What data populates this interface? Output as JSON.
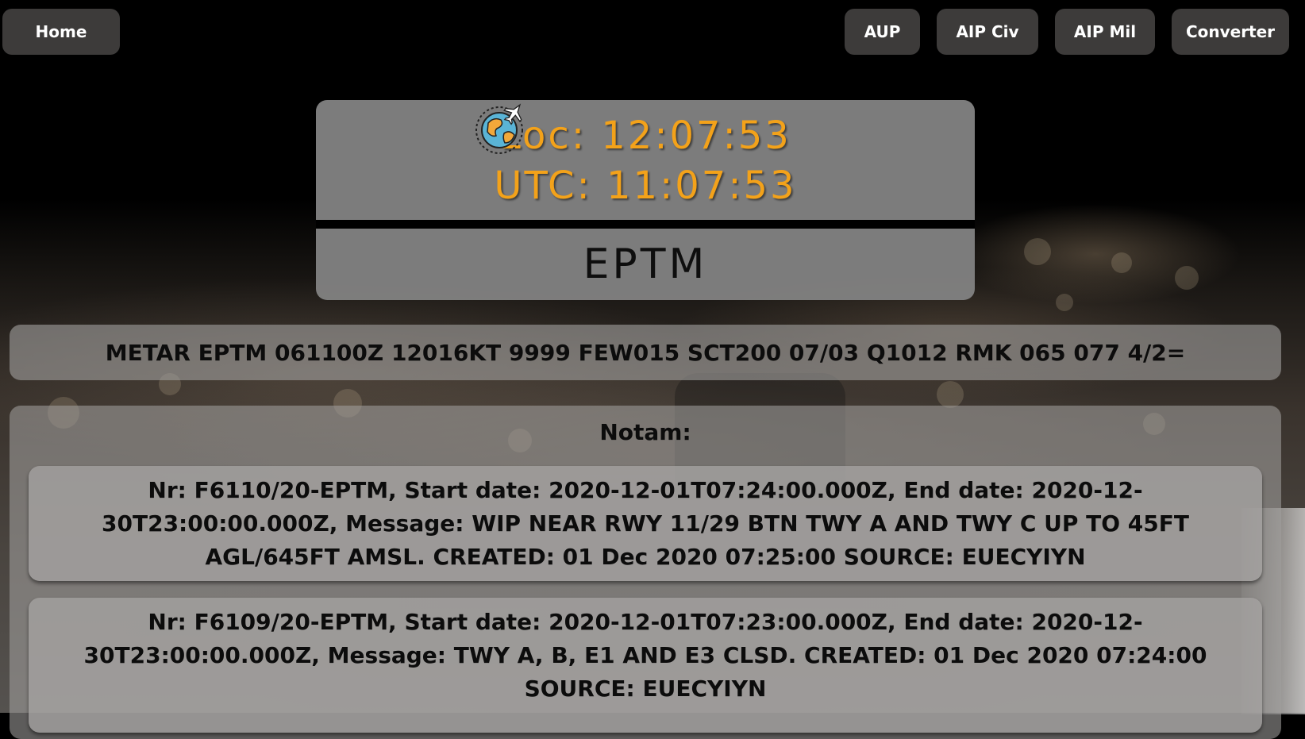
{
  "nav": {
    "home": "Home",
    "aup": "AUP",
    "aip_civ": "AIP Civ",
    "aip_mil": "AIP Mil",
    "converter": "Converter"
  },
  "clock": {
    "local": "Loc: 12:07:53",
    "utc": "UTC: 11:07:53",
    "icon": "globe-airplane-icon"
  },
  "airport": {
    "icao": "EPTM"
  },
  "metar": "METAR EPTM 061100Z 12016KT 9999 FEW015 SCT200 07/03 Q1012 RMK 065 077 4/2=",
  "notam": {
    "title": "Notam:",
    "items": [
      "Nr: F6110/20-EPTM, Start date: 2020-12-01T07:24:00.000Z, End date: 2020-12-30T23:00:00.000Z, Message: WIP NEAR RWY 11/29 BTN TWY A AND TWY C UP TO 45FT AGL/645FT AMSL. CREATED: 01 Dec 2020 07:25:00 SOURCE: EUECYIYN",
      "Nr: F6109/20-EPTM, Start date: 2020-12-01T07:23:00.000Z, End date: 2020-12-30T23:00:00.000Z, Message: TWY A, B, E1 AND E3 CLSD. CREATED: 01 Dec 2020 07:24:00 SOURCE: EUECYIYN"
    ]
  },
  "colors": {
    "clock_text": "#f3a21a",
    "nav_button": "#3d3b3a",
    "panel": "#808080"
  }
}
